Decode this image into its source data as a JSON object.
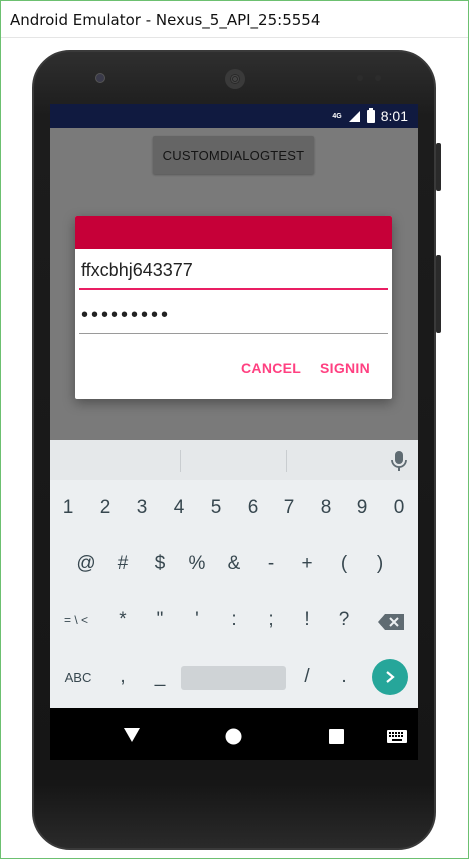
{
  "window": {
    "title": "Android Emulator - Nexus_5_API_25:5554"
  },
  "status_bar": {
    "network": "4G",
    "time": "8:01"
  },
  "app": {
    "button_label": "CUSTOMDIALOGTEST"
  },
  "dialog": {
    "username_value": "ffxcbhj643377",
    "password_value": "•••••••••",
    "cancel_label": "CANCEL",
    "signin_label": "SIGNIN",
    "header_color": "#c60038",
    "accent_color": "#ff4081"
  },
  "keyboard": {
    "row1": [
      "1",
      "2",
      "3",
      "4",
      "5",
      "6",
      "7",
      "8",
      "9",
      "0"
    ],
    "row2": [
      "@",
      "#",
      "$",
      "%",
      "&",
      "-",
      "+",
      "(",
      ")"
    ],
    "row3": [
      "= \\ <",
      "*",
      "\"",
      "'",
      ":",
      ";",
      "!",
      "?"
    ],
    "row4": [
      "ABC",
      ",",
      "_",
      "/",
      "."
    ],
    "icons": {
      "voice": "microphone-icon",
      "delete": "backspace-icon",
      "enter": "chevron-right-icon"
    }
  },
  "nav": {
    "back": "back-triangle-icon",
    "home": "home-circle-icon",
    "recents": "recents-square-icon",
    "ime": "keyboard-icon"
  }
}
